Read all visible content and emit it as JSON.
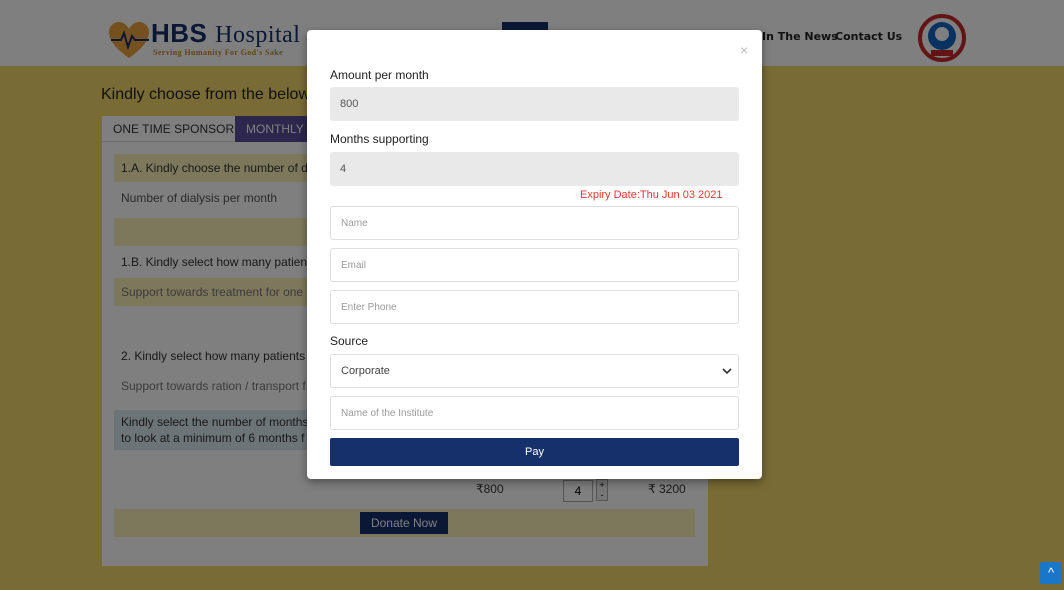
{
  "header": {
    "logo": {
      "brand_bold": "HBS",
      "brand_rest": "Hospital",
      "tagline": "Serving Humanity For God's Sake"
    },
    "nav": [
      {
        "label": "In The News"
      },
      {
        "label": "Contact Us"
      }
    ]
  },
  "page": {
    "intro": "Kindly choose from the below c",
    "tabs": [
      {
        "label": "ONE TIME SPONSOR"
      },
      {
        "label": "MONTHLY S"
      }
    ],
    "rows": [
      "1.A. Kindly choose the number of di",
      "Number of dialysis per month",
      "1.B. Kindly select how many patient",
      "Support towards treatment for one",
      "2. Kindly select how many patients",
      "Support towards ration / transport f"
    ],
    "months_note_line1": "Kindly select the number of months",
    "months_note_line2": "to look at a minimum of 6 months f",
    "amount": "₹800",
    "months_value": "4",
    "total": "₹ 3200",
    "stepper_up": "+",
    "stepper_down": "-",
    "donate_label": "Donate Now"
  },
  "modal": {
    "close_glyph": "×",
    "amount_label": "Amount per month",
    "amount_value": "800",
    "months_label": "Months supporting",
    "months_value": "4",
    "expiry": "Expiry Date:Thu Jun 03 2021",
    "name_placeholder": "Name",
    "email_placeholder": "Email",
    "phone_placeholder": "Enter Phone",
    "source_label": "Source",
    "source_value": "Corporate",
    "institute_placeholder": "Name of the Institute",
    "pay_label": "Pay"
  },
  "scroll_top_glyph": "^",
  "colors": {
    "brand_navy": "#16306b",
    "page_yellow": "#f2d66b",
    "tab_purple": "#5a4d9a",
    "expiry_red": "#e53935"
  }
}
